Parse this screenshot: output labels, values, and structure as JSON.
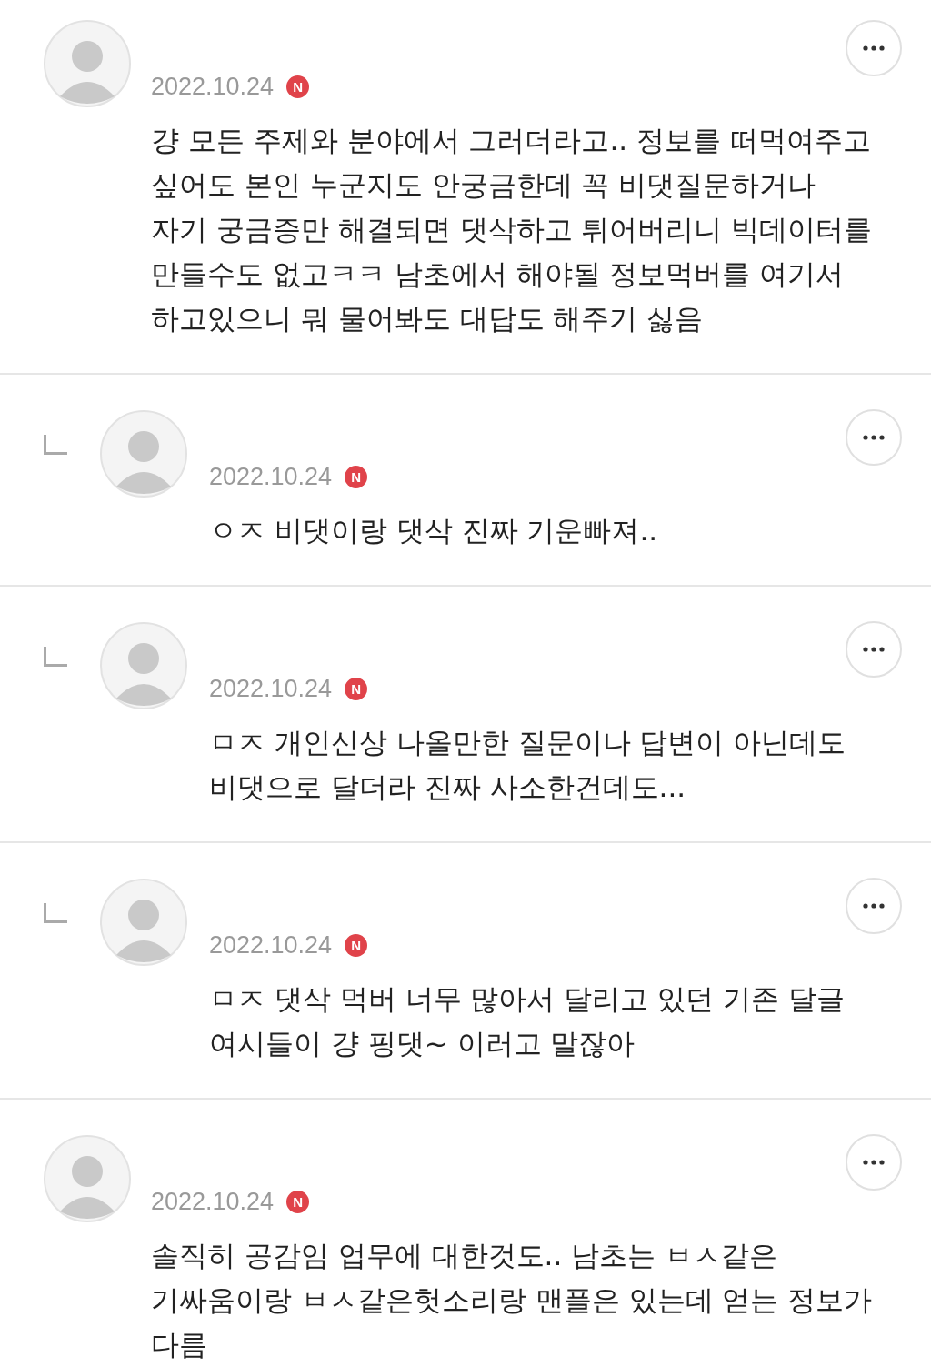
{
  "comments": [
    {
      "kind": "comment",
      "date": "2022.10.24",
      "badge": "N",
      "text": "걍 모든 주제와 분야에서 그러더라고.. 정보를 떠먹여주고 싶어도 본인 누군지도 안궁금한데 꼭 비댓질문하거나 자기 궁금증만 해결되면 댓삭하고 튀어버리니 빅데이터를 만들수도 없고ㅋㅋ 남초에서 해야될 정보먹버를 여기서 하고있으니 뭐 물어봐도 대답도 해주기 싫음"
    },
    {
      "kind": "reply",
      "date": "2022.10.24",
      "badge": "N",
      "text": "ㅇㅈ 비댓이랑 댓삭 진짜 기운빠져.."
    },
    {
      "kind": "reply",
      "date": "2022.10.24",
      "badge": "N",
      "text": "ㅁㅈ 개인신상 나올만한 질문이나 답변이 아닌데도 비댓으로 달더라 진짜 사소한건데도..."
    },
    {
      "kind": "reply",
      "date": "2022.10.24",
      "badge": "N",
      "text": "ㅁㅈ 댓삭 먹버 너무 많아서 달리고 있던 기존 달글 여시들이 걍 핑댓~ 이러고 말잖아"
    },
    {
      "kind": "comment",
      "date": "2022.10.24",
      "badge": "N",
      "text": "솔직히 공감임 업무에 대한것도.. 남초는 ㅂㅅ같은 기싸움이랑 ㅂㅅ같은헛소리랑 맨플은 있는데 얻는 정보가 다름"
    }
  ]
}
